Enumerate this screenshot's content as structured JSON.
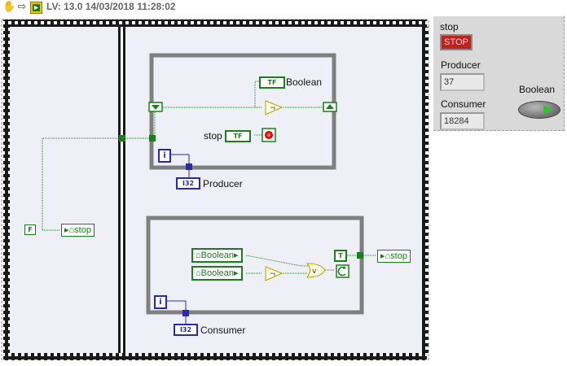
{
  "toolbar": {
    "icons": [
      "hand-icon",
      "run-arrow-icon",
      "labview-vi-icon"
    ],
    "version_text": "LV: 13.0 14/03/2018 11:28:02"
  },
  "colors": {
    "boolean_wire": "#1a7f1a",
    "integer_wire": "#2a2aa8",
    "loop_border": "#7f7f7f",
    "stop_button": "#c02020"
  },
  "diagram": {
    "init_constant": "F",
    "init_local": "stop",
    "producer": {
      "boolean_indicator": "Boolean",
      "stop_label": "stop",
      "tf_glyph": "TF",
      "iteration_label": "i",
      "counter_label": "Producer",
      "counter_glyph": "I32"
    },
    "consumer": {
      "local_a": "Boolean",
      "local_b": "Boolean",
      "true_constant": "T",
      "stop_local": "stop",
      "iteration_label": "i",
      "counter_label": "Consumer",
      "counter_glyph": "I32"
    }
  },
  "front_panel": {
    "stop_label": "stop",
    "stop_button_text": "STOP",
    "producer_label": "Producer",
    "producer_value": "37",
    "consumer_label": "Consumer",
    "consumer_value": "18284",
    "boolean_label": "Boolean",
    "boolean_led_state": "on"
  }
}
